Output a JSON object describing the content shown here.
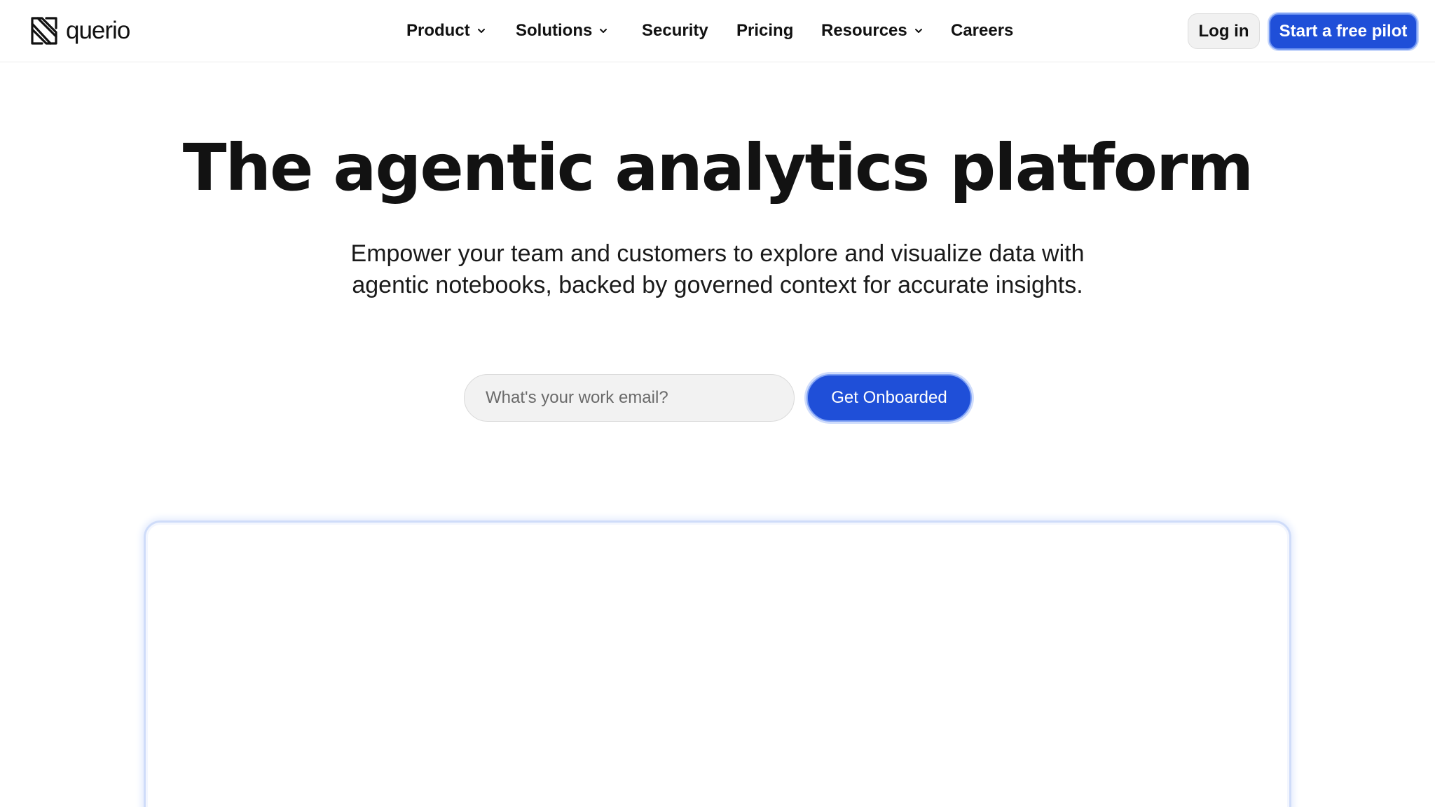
{
  "brand": {
    "name": "querio"
  },
  "nav": {
    "items": [
      {
        "label": "Product",
        "has_dropdown": true
      },
      {
        "label": "Solutions",
        "has_dropdown": true
      },
      {
        "label": "Security",
        "has_dropdown": false
      },
      {
        "label": "Pricing",
        "has_dropdown": false
      },
      {
        "label": "Resources",
        "has_dropdown": true
      },
      {
        "label": "Careers",
        "has_dropdown": false
      }
    ]
  },
  "header_actions": {
    "login_label": "Log in",
    "pilot_label": "Start a free pilot"
  },
  "hero": {
    "title": "The agentic analytics platform",
    "subtitle_line1": "Empower your team and customers to explore and visualize data with",
    "subtitle_line2": "agentic notebooks, backed by governed context for accurate insights."
  },
  "signup": {
    "email_placeholder": "What's your work email?",
    "email_value": "",
    "submit_label": "Get Onboarded"
  },
  "colors": {
    "accent": "#1f4fd8",
    "accent_ring": "#cfdcfb",
    "text": "#111111",
    "input_bg": "#f2f2f2"
  },
  "icons": {
    "logo": "querio-logo-icon",
    "dropdown": "chevron-down-icon"
  }
}
